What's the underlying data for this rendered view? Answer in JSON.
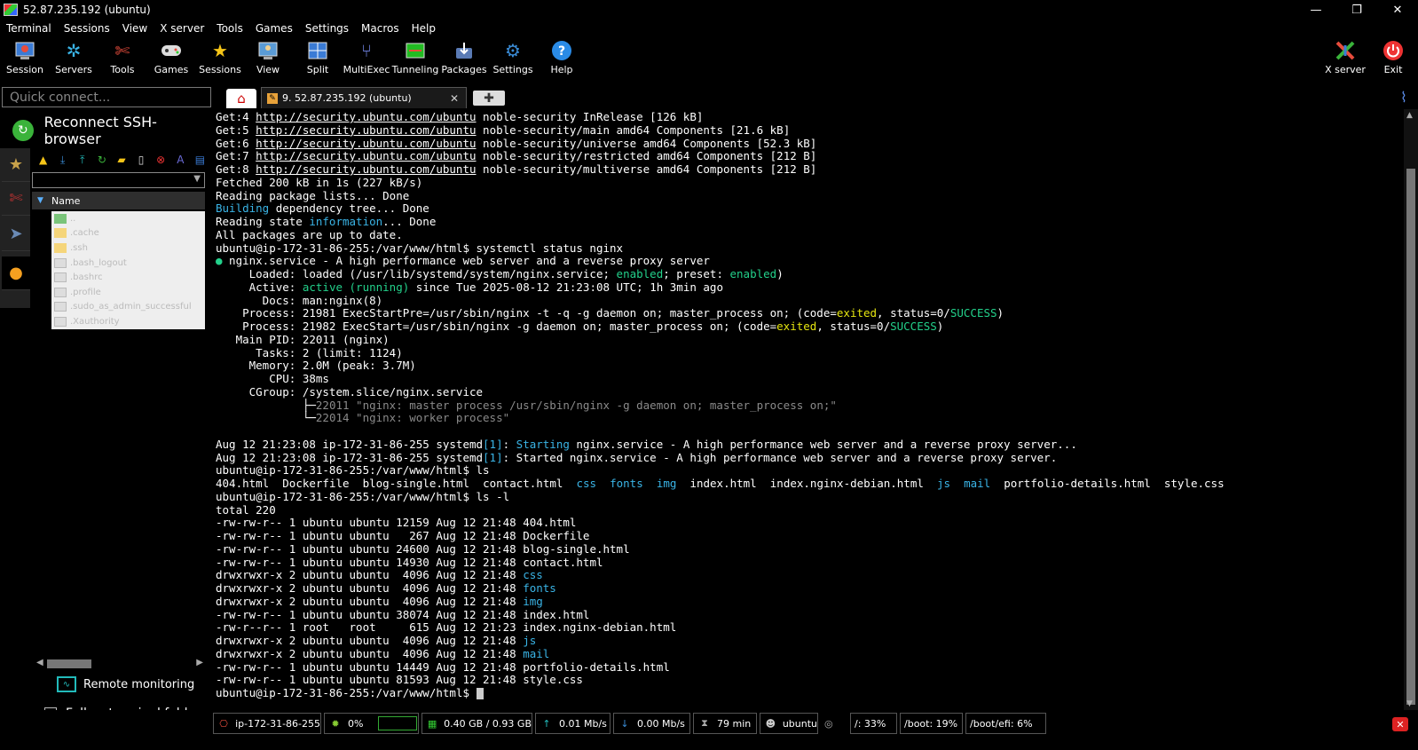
{
  "window": {
    "title": "52.87.235.192 (ubuntu)",
    "minimize": "—",
    "maximize": "❐",
    "close": "✕"
  },
  "menu": [
    "Terminal",
    "Sessions",
    "View",
    "X server",
    "Tools",
    "Games",
    "Settings",
    "Macros",
    "Help"
  ],
  "toolbar": {
    "session": "Session",
    "servers": "Servers",
    "tools": "Tools",
    "games": "Games",
    "sessions": "Sessions",
    "view": "View",
    "split": "Split",
    "multiexec": "MultiExec",
    "tunneling": "Tunneling",
    "packages": "Packages",
    "settings": "Settings",
    "help": "Help",
    "xserver": "X server",
    "exit": "Exit"
  },
  "quick_connect": {
    "placeholder": "Quick connect..."
  },
  "tabs": {
    "session_label": "9. 52.87.235.192 (ubuntu)"
  },
  "sidebar": {
    "reconnect_label": "Reconnect SSH-browser",
    "column_name": "Name",
    "files": [
      "..",
      ".cache",
      ".ssh",
      ".bash_logout",
      ".bashrc",
      ".profile",
      ".sudo_as_admin_successful",
      ".Xauthority"
    ],
    "remote_monitoring": "Remote monitoring",
    "follow_terminal": "Follow terminal folder",
    "follow_checked": "✓"
  },
  "terminal": {
    "apt": [
      {
        "prefix": "Get:4 ",
        "url": "http://security.ubuntu.com/ubuntu",
        "rest": " noble-security InRelease [126 kB]"
      },
      {
        "prefix": "Get:5 ",
        "url": "http://security.ubuntu.com/ubuntu",
        "rest": " noble-security/main amd64 Components [21.6 kB]"
      },
      {
        "prefix": "Get:6 ",
        "url": "http://security.ubuntu.com/ubuntu",
        "rest": " noble-security/universe amd64 Components [52.3 kB]"
      },
      {
        "prefix": "Get:7 ",
        "url": "http://security.ubuntu.com/ubuntu",
        "rest": " noble-security/restricted amd64 Components [212 B]"
      },
      {
        "prefix": "Get:8 ",
        "url": "http://security.ubuntu.com/ubuntu",
        "rest": " noble-security/multiverse amd64 Components [212 B]"
      }
    ],
    "fetched": "Fetched 200 kB in 1s (227 kB/s)",
    "reading_lists": "Reading package lists... Done",
    "building": {
      "a": "Building",
      "b": " dependency tree... Done"
    },
    "reading_state": {
      "a": "Reading state ",
      "b": "information",
      "c": "... Done"
    },
    "uptodate": "All packages are up to date.",
    "prompt": "ubuntu@ip-172-31-86-255:/var/www/html$ ",
    "cmd_status": "systemctl status nginx",
    "svc": {
      "dot": "●",
      "text": " nginx.service - A high performance web server and a reverse proxy server"
    },
    "loaded": {
      "a": "     Loaded: loaded (/usr/lib/systemd/system/nginx.service; ",
      "b": "enabled",
      "c": "; preset: ",
      "d": "enabled",
      "e": ")"
    },
    "active": {
      "a": "     Active: ",
      "b": "active (running)",
      "c": " since Tue 2025-08-12 21:23:08 UTC; 1h 3min ago"
    },
    "docs": "       Docs: man:nginx(8)",
    "proc1": {
      "a": "    Process: 21981 ExecStartPre=/usr/sbin/nginx -t -q -g daemon on; master_process on; (code=",
      "b": "exited",
      "c": ", status=0/",
      "d": "SUCCESS",
      "e": ")"
    },
    "proc2": {
      "a": "    Process: 21982 ExecStart=/usr/sbin/nginx -g daemon on; master_process on; (code=",
      "b": "exited",
      "c": ", status=0/",
      "d": "SUCCESS",
      "e": ")"
    },
    "mainpid": "   Main PID: 22011 (nginx)",
    "tasks": "      Tasks: 2 (limit: 1124)",
    "memory": "     Memory: 2.0M (peak: 3.7M)",
    "cpu": "        CPU: 38ms",
    "cgroup": "     CGroup: /system.slice/nginx.service",
    "cg1": {
      "a": "             ├─",
      "b": "22011 \"nginx: master process /usr/sbin/nginx -g daemon on; master_process on;\""
    },
    "cg2": {
      "a": "             └─",
      "b": "22014 \"nginx: worker process\""
    },
    "log1": {
      "a": "Aug 12 21:23:08 ip-172-31-86-255 systemd",
      "b": "[1]",
      "c": ": ",
      "d": "Starting",
      "e": " nginx.service - A high performance web server and a reverse proxy server..."
    },
    "log2": {
      "a": "Aug 12 21:23:08 ip-172-31-86-255 systemd",
      "b": "[1]",
      "c": ": Started nginx.service - A high performance web server and a reverse proxy server."
    },
    "cmd_ls": "ls",
    "ls_out": [
      {
        "t": "404.html",
        "dir": false
      },
      {
        "t": "  ",
        "dir": false
      },
      {
        "t": "Dockerfile",
        "dir": false
      },
      {
        "t": "  ",
        "dir": false
      },
      {
        "t": "blog-single.html",
        "dir": false
      },
      {
        "t": "  ",
        "dir": false
      },
      {
        "t": "contact.html",
        "dir": false
      },
      {
        "t": "  ",
        "dir": false
      },
      {
        "t": "css",
        "dir": true
      },
      {
        "t": "  ",
        "dir": false
      },
      {
        "t": "fonts",
        "dir": true
      },
      {
        "t": "  ",
        "dir": false
      },
      {
        "t": "img",
        "dir": true
      },
      {
        "t": "  ",
        "dir": false
      },
      {
        "t": "index.html",
        "dir": false
      },
      {
        "t": "  ",
        "dir": false
      },
      {
        "t": "index.nginx-debian.html",
        "dir": false
      },
      {
        "t": "  ",
        "dir": false
      },
      {
        "t": "js",
        "dir": true
      },
      {
        "t": "  ",
        "dir": false
      },
      {
        "t": "mail",
        "dir": true
      },
      {
        "t": "  ",
        "dir": false
      },
      {
        "t": "portfolio-details.html",
        "dir": false
      },
      {
        "t": "  ",
        "dir": false
      },
      {
        "t": "style.css",
        "dir": false
      }
    ],
    "cmd_lsl": "ls -l",
    "total": "total 220",
    "lsl": [
      {
        "meta": "-rw-rw-r-- 1 ubuntu ubuntu 12159 Aug 12 21:48 ",
        "name": "404.html",
        "dir": false
      },
      {
        "meta": "-rw-rw-r-- 1 ubuntu ubuntu   267 Aug 12 21:48 ",
        "name": "Dockerfile",
        "dir": false
      },
      {
        "meta": "-rw-rw-r-- 1 ubuntu ubuntu 24600 Aug 12 21:48 ",
        "name": "blog-single.html",
        "dir": false
      },
      {
        "meta": "-rw-rw-r-- 1 ubuntu ubuntu 14930 Aug 12 21:48 ",
        "name": "contact.html",
        "dir": false
      },
      {
        "meta": "drwxrwxr-x 2 ubuntu ubuntu  4096 Aug 12 21:48 ",
        "name": "css",
        "dir": true
      },
      {
        "meta": "drwxrwxr-x 2 ubuntu ubuntu  4096 Aug 12 21:48 ",
        "name": "fonts",
        "dir": true
      },
      {
        "meta": "drwxrwxr-x 2 ubuntu ubuntu  4096 Aug 12 21:48 ",
        "name": "img",
        "dir": true
      },
      {
        "meta": "-rw-rw-r-- 1 ubuntu ubuntu 38074 Aug 12 21:48 ",
        "name": "index.html",
        "dir": false
      },
      {
        "meta": "-rw-r--r-- 1 root   root     615 Aug 12 21:23 ",
        "name": "index.nginx-debian.html",
        "dir": false
      },
      {
        "meta": "drwxrwxr-x 2 ubuntu ubuntu  4096 Aug 12 21:48 ",
        "name": "js",
        "dir": true
      },
      {
        "meta": "drwxrwxr-x 2 ubuntu ubuntu  4096 Aug 12 21:48 ",
        "name": "mail",
        "dir": true
      },
      {
        "meta": "-rw-rw-r-- 1 ubuntu ubuntu 14449 Aug 12 21:48 ",
        "name": "portfolio-details.html",
        "dir": false
      },
      {
        "meta": "-rw-rw-r-- 1 ubuntu ubuntu 81593 Aug 12 21:48 ",
        "name": "style.css",
        "dir": false
      }
    ]
  },
  "status": {
    "host": "ip-172-31-86-255",
    "cpu": "0%",
    "mem": "0.40 GB / 0.93 GB",
    "upload": "0.01 Mb/s",
    "download": "0.00 Mb/s",
    "uptime": "79 min",
    "user": "ubuntu",
    "disk_root": "/: 33%",
    "disk_boot": "/boot: 19%",
    "disk_efi": "/boot/efi: 6%"
  },
  "colors": {
    "dir": "#3ab4e6",
    "success": "#23d18b",
    "warn": "#e5e510"
  }
}
